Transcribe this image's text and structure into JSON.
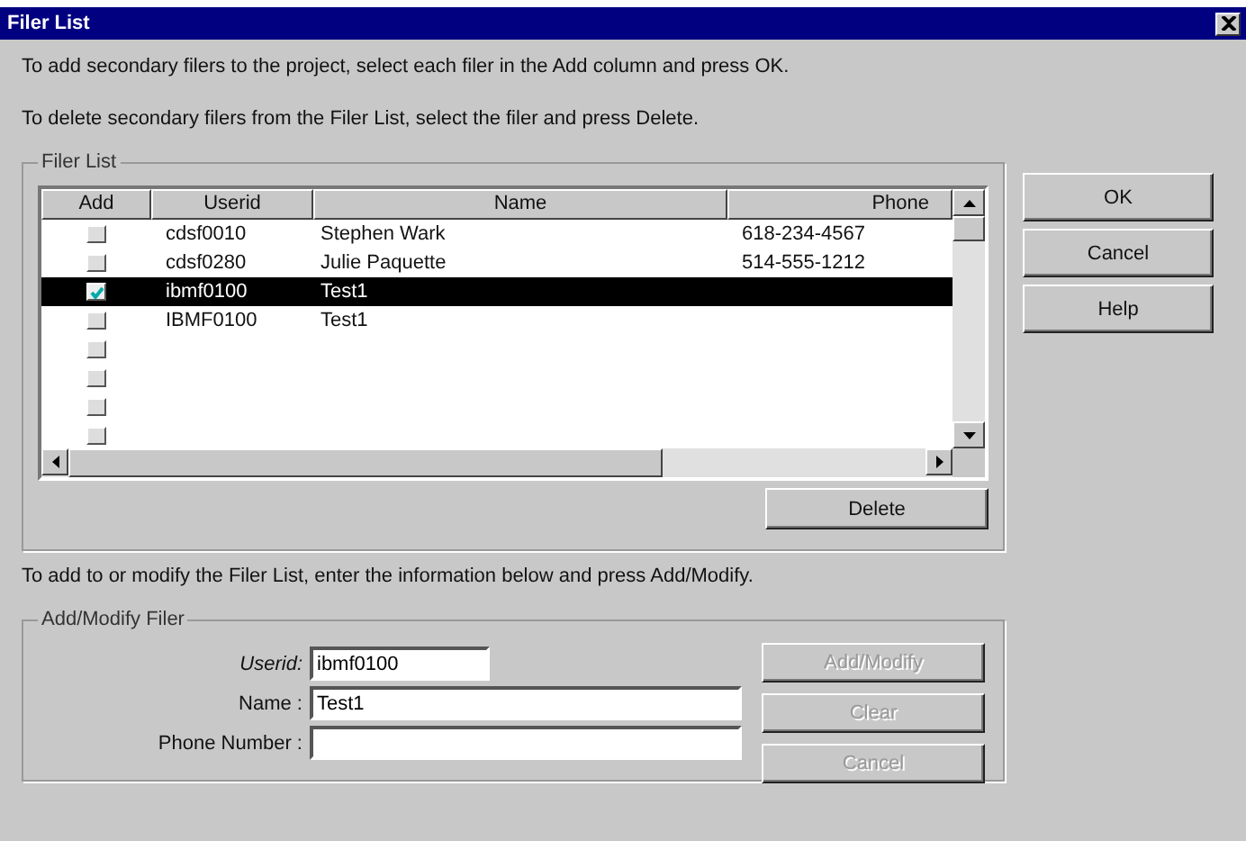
{
  "window": {
    "title": "Filer List"
  },
  "instructions": [
    "To add secondary filers to the project, select each filer in the Add column and press OK.",
    "To delete secondary filers from the Filer List, select the filer and press Delete."
  ],
  "filer_list": {
    "legend": "Filer List",
    "columns": [
      "Add",
      "Userid",
      "Name",
      "Phone"
    ],
    "rows": [
      {
        "checked": false,
        "selected": false,
        "userid": "cdsf0010",
        "name": "Stephen Wark",
        "phone": "618-234-4567"
      },
      {
        "checked": false,
        "selected": false,
        "userid": "cdsf0280",
        "name": "Julie Paquette",
        "phone": "514-555-1212"
      },
      {
        "checked": true,
        "selected": true,
        "userid": "ibmf0100",
        "name": "Test1"
      },
      {
        "checked": false,
        "selected": false,
        "userid": "IBMF0100",
        "name": "Test1"
      },
      {
        "checked": false,
        "selected": false
      },
      {
        "checked": false,
        "selected": false
      },
      {
        "checked": false,
        "selected": false
      },
      {
        "checked": false,
        "selected": false
      }
    ],
    "delete_button": "Delete"
  },
  "side_buttons": [
    "OK",
    "Cancel",
    "Help"
  ],
  "modify_instruction": "To add to or modify the Filer List, enter the information below and press Add/Modify.",
  "add_modify": {
    "legend": "Add/Modify Filer",
    "fields": [
      {
        "label": "Userid:",
        "value": "ibmf0100",
        "kind": "short",
        "italic": true
      },
      {
        "label": "Name :",
        "value": "Test1",
        "kind": "wide",
        "italic": false
      },
      {
        "label": "Phone Number :",
        "kind": "wide",
        "italic": false
      }
    ],
    "buttons": [
      {
        "label": "Add/Modify",
        "disabled": true
      },
      {
        "label": "Clear",
        "disabled": true
      },
      {
        "label": "Cancel",
        "disabled": true
      }
    ]
  }
}
